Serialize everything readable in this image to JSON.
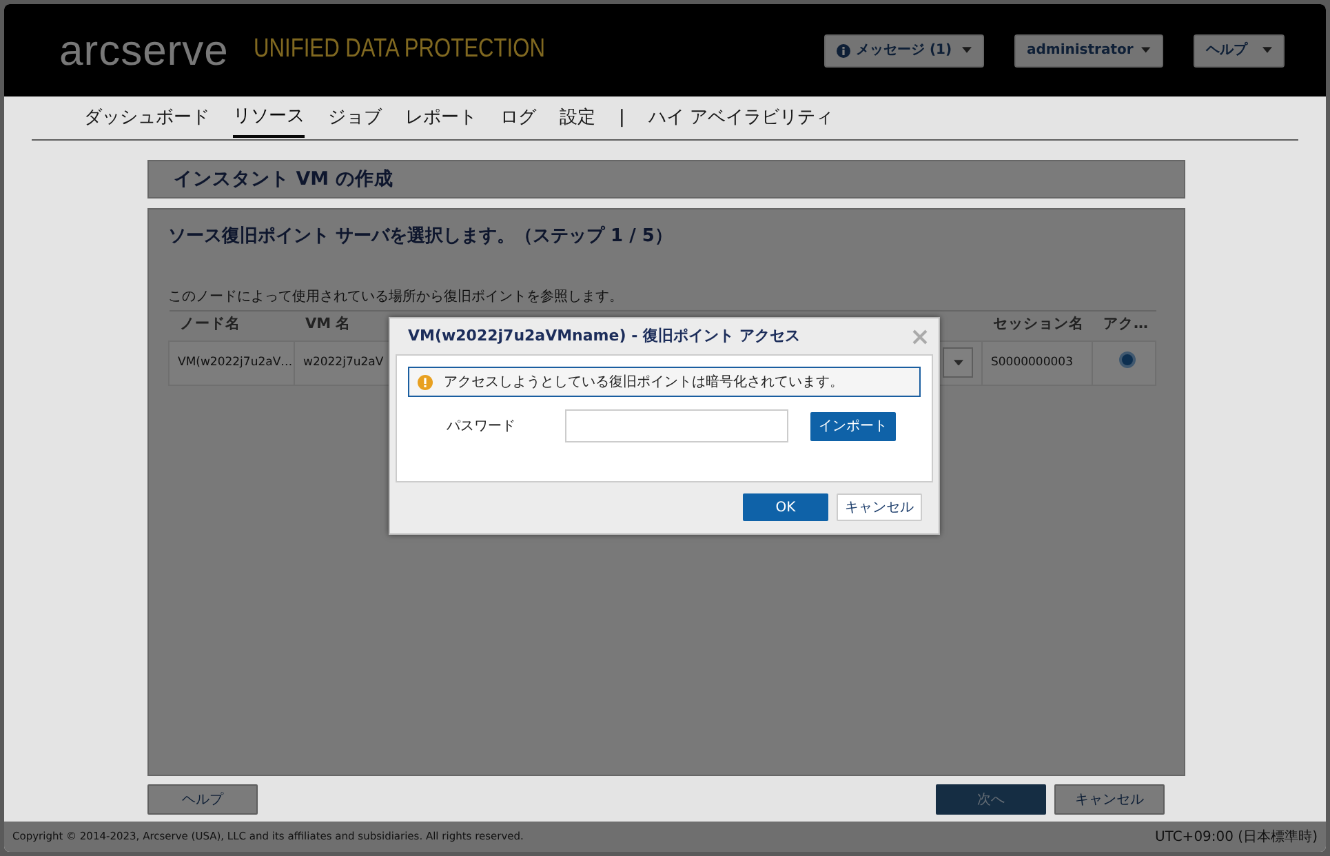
{
  "header": {
    "logo": "arcserve",
    "product": "UNIFIED DATA PROTECTION",
    "menus": [
      {
        "label": "メッセージ (1)",
        "kind": "info"
      },
      {
        "label": "administrator",
        "kind": "plain"
      },
      {
        "label": "ヘルプ",
        "kind": "plain"
      }
    ]
  },
  "nav": [
    {
      "label": "ダッシュボード",
      "selected": false,
      "kind": "tab"
    },
    {
      "label": "リソース",
      "selected": true,
      "kind": "tab"
    },
    {
      "label": "ジョブ",
      "selected": false,
      "kind": "tab"
    },
    {
      "label": "レポート",
      "selected": false,
      "kind": "tab"
    },
    {
      "label": "ログ",
      "selected": false,
      "kind": "tab"
    },
    {
      "label": "設定",
      "selected": false,
      "kind": "tab"
    },
    {
      "label": "|",
      "kind": "separator"
    },
    {
      "label": "ハイ アベイラビリティ",
      "selected": false,
      "kind": "tab"
    }
  ],
  "page": {
    "title": "インスタント VM の作成",
    "step_title": "ソース復旧ポイント サーバを選択します。（ステップ 1 / 5）",
    "instruction": "このノードによって使用されている場所から復旧ポイントを参照します。",
    "table": {
      "columns": [
        "ノード名",
        "VM 名",
        null,
        null,
        null,
        null,
        null,
        "セッション名",
        "アク…"
      ],
      "rows": [
        {
          "cells": [
            {
              "kind": "text",
              "text": "VM(w2022j7u2aV…"
            },
            {
              "kind": "text",
              "text": "w2022j7u2aV"
            },
            {
              "kind": "empty"
            },
            {
              "kind": "empty"
            },
            {
              "kind": "empty"
            },
            {
              "kind": "empty"
            },
            {
              "kind": "select"
            },
            {
              "kind": "text",
              "text": "S0000000003"
            },
            {
              "kind": "action"
            }
          ]
        }
      ]
    }
  },
  "footer_buttons": [
    {
      "label": "ヘルプ",
      "disabled": false,
      "primary": false
    },
    {
      "label": "次へ",
      "disabled": true,
      "primary": true
    },
    {
      "label": "キャンセル",
      "disabled": false,
      "primary": false
    }
  ],
  "status_bar": {
    "copyright": "Copyright © 2014-2023, Arcserve (USA), LLC and its affiliates and subsidiaries. All rights reserved.",
    "timezone": "UTC+09:00 (日本標準時)"
  },
  "dialog": {
    "title": "VM(w2022j7u2aVMname) - 復旧ポイント アクセス",
    "alert": "アクセスしようとしている復旧ポイントは暗号化されています。",
    "password_label": "パスワード",
    "import_button": "インポート",
    "buttons": [
      {
        "label": "OK",
        "primary": true
      },
      {
        "label": "キャンセル",
        "primary": false
      }
    ]
  }
}
